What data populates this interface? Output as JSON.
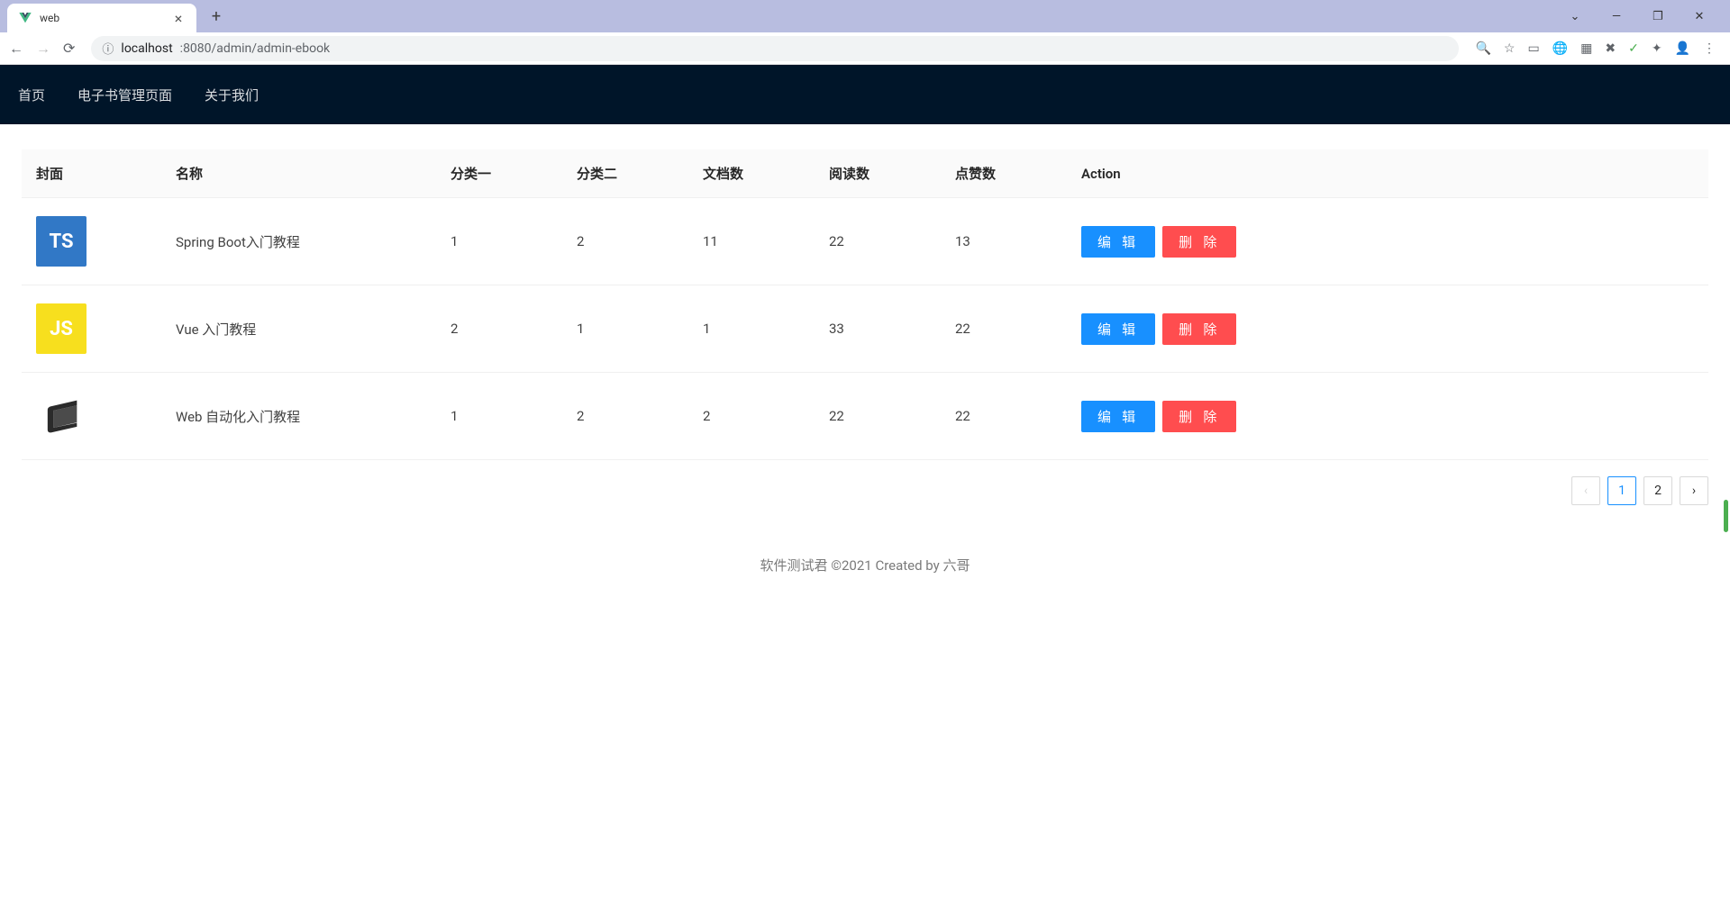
{
  "browser": {
    "tab_title": "web",
    "url_host": "localhost",
    "url_path": ":8080/admin/admin-ebook"
  },
  "nav": {
    "items": [
      "首页",
      "电子书管理页面",
      "关于我们"
    ]
  },
  "table": {
    "columns": [
      "封面",
      "名称",
      "分类一",
      "分类二",
      "文档数",
      "阅读数",
      "点赞数",
      "Action"
    ],
    "action_labels": {
      "edit": "编 辑",
      "delete": "删 除"
    },
    "rows": [
      {
        "cover_type": "ts",
        "cover_text": "TS",
        "name": "Spring Boot入门教程",
        "cat1": "1",
        "cat2": "2",
        "docs": "11",
        "views": "22",
        "likes": "13"
      },
      {
        "cover_type": "js",
        "cover_text": "JS",
        "name": "Vue 入门教程",
        "cat1": "2",
        "cat2": "1",
        "docs": "1",
        "views": "33",
        "likes": "22"
      },
      {
        "cover_type": "book",
        "cover_text": "",
        "name": "Web 自动化入门教程",
        "cat1": "1",
        "cat2": "2",
        "docs": "2",
        "views": "22",
        "likes": "22"
      }
    ]
  },
  "pagination": {
    "pages": [
      "1",
      "2"
    ],
    "current": "1"
  },
  "footer": "软件测试君 ©2021 Created by 六哥"
}
